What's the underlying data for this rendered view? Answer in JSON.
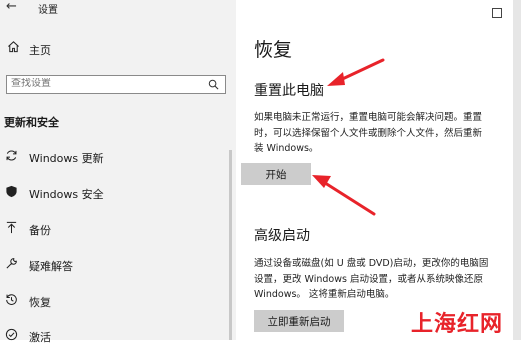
{
  "window": {
    "title": "设置"
  },
  "sidebar": {
    "home_label": "主页",
    "search_placeholder": "查找设置",
    "section_title": "更新和安全",
    "items": [
      {
        "label": "Windows 更新",
        "icon": "sync-icon"
      },
      {
        "label": "Windows 安全",
        "icon": "shield-icon"
      },
      {
        "label": "备份",
        "icon": "backup-arrow-icon"
      },
      {
        "label": "疑难解答",
        "icon": "wrench-icon"
      },
      {
        "label": "恢复",
        "icon": "history-icon"
      },
      {
        "label": "激活",
        "icon": "check-circle-icon"
      }
    ]
  },
  "main": {
    "title": "恢复",
    "reset": {
      "heading": "重置此电脑",
      "desc_line1": "如果电脑未正常运行，重置电脑可能会解决问题。重置",
      "desc_line2": "时，可以选择保留个人文件或删除个人文件，然后重新",
      "desc_line3": "装 Windows。",
      "button": "开始"
    },
    "advanced": {
      "heading": "高级启动",
      "desc_line1": "通过设备或磁盘(如 U 盘或 DVD)启动，更改你的电脑固",
      "desc_line2": "设置，更改 Windows 启动设置，或者从系统映像还原",
      "desc_line3": "Windows。 这将重新启动电脑。",
      "button": "立即重新启动"
    }
  },
  "watermark": "上海红网",
  "colors": {
    "sidebar_bg": "#f2f2f2",
    "button_bg": "#cccccc",
    "arrow": "#e8232a",
    "watermark": "#e8232a"
  }
}
